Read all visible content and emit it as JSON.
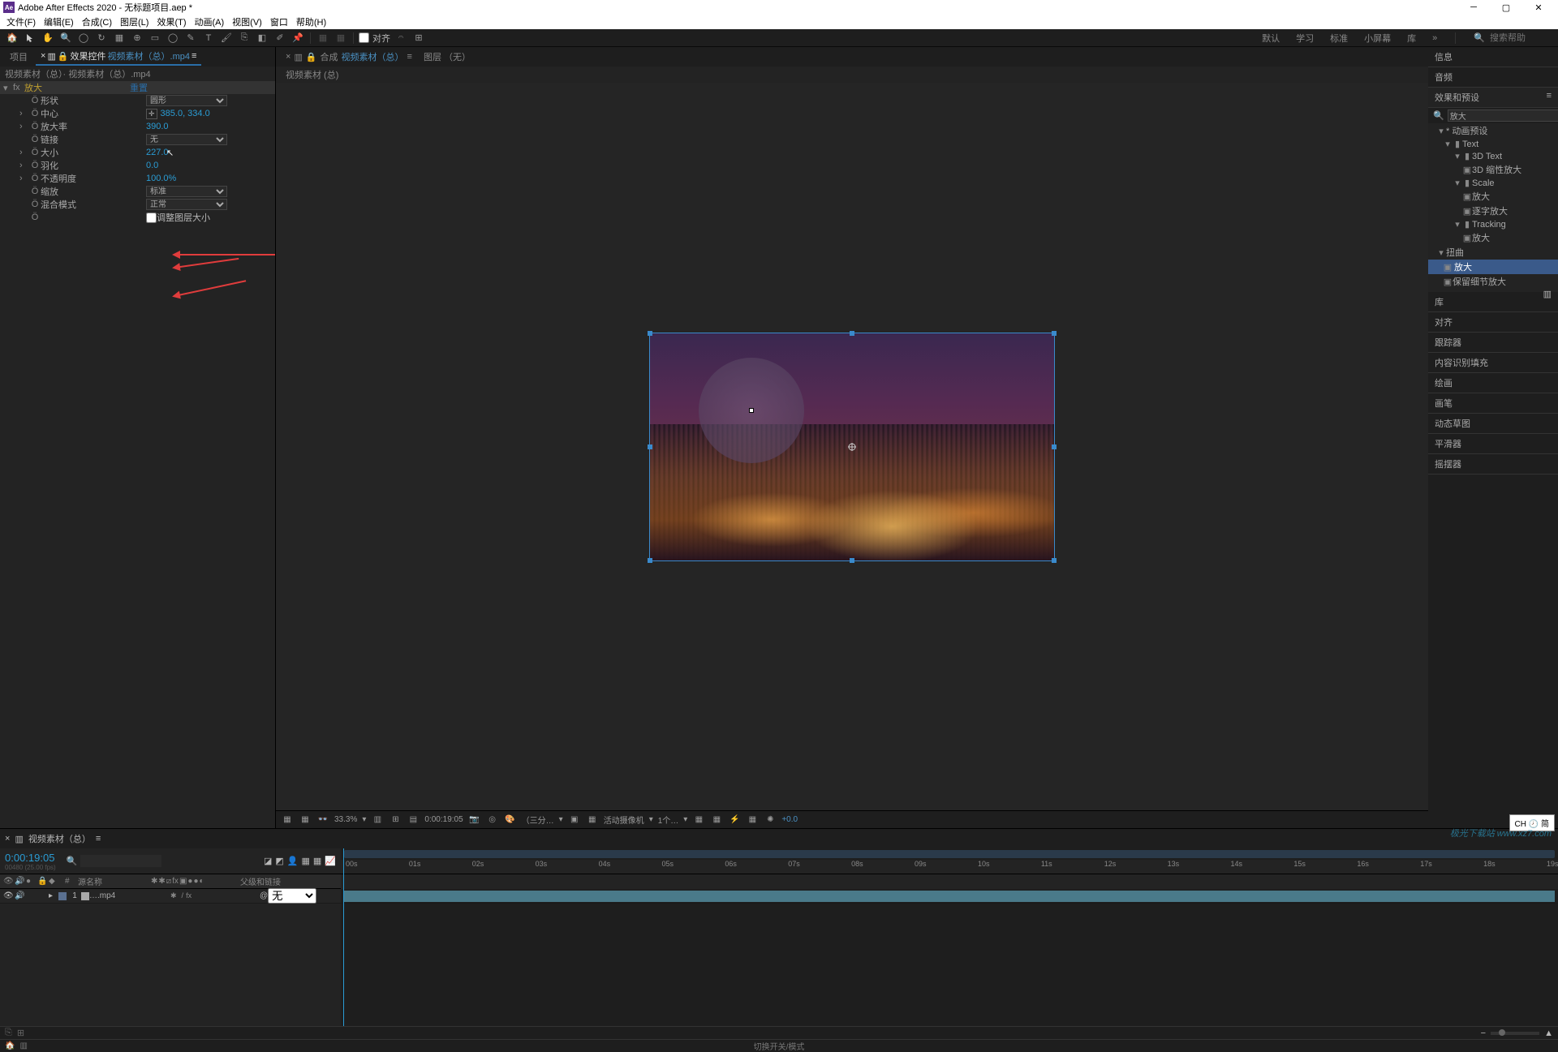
{
  "titlebar": {
    "app_icon_text": "Ae",
    "title": "Adobe After Effects 2020 - 无标题项目.aep *"
  },
  "menus": [
    "文件(F)",
    "编辑(E)",
    "合成(C)",
    "图层(L)",
    "效果(T)",
    "动画(A)",
    "视图(V)",
    "窗口",
    "帮助(H)"
  ],
  "toolbar": {
    "snap_label": "对齐",
    "workspaces": [
      "默认",
      "学习",
      "标准",
      "小屏幕",
      "库"
    ],
    "search_placeholder": "搜索帮助"
  },
  "left_panel": {
    "tabs": {
      "project": "项目",
      "effect_controls": "效果控件",
      "effect_controls_suffix": "视频素材（总）.mp4"
    },
    "subheader": "视频素材（总）· 视频素材（总）.mp4",
    "effect_name": "放大",
    "reset": "重置",
    "rows": [
      {
        "name": "形状",
        "type": "select",
        "value": "圆形"
      },
      {
        "name": "中心",
        "type": "coord",
        "value": "385.0, 334.0",
        "has_crosshair": true
      },
      {
        "name": "放大率",
        "type": "num",
        "value": "390.0"
      },
      {
        "name": "链接",
        "type": "select",
        "value": "无"
      },
      {
        "name": "大小",
        "type": "num",
        "value": "227.0"
      },
      {
        "name": "羽化",
        "type": "num",
        "value": "0.0"
      },
      {
        "name": "不透明度",
        "type": "num",
        "value": "100.0%"
      },
      {
        "name": "缩放",
        "type": "select",
        "value": "标准"
      },
      {
        "name": "混合模式",
        "type": "select",
        "value": "正常"
      },
      {
        "name": "",
        "type": "check",
        "value": "调整图层大小"
      }
    ]
  },
  "center": {
    "tab_prefix": "合成",
    "tab_name": "视频素材（总）",
    "layer_label": "图层 （无）",
    "comp_name": "视频素材 (总)",
    "bottom": {
      "zoom": "33.3%",
      "time": "0:00:19:05",
      "res": "（三分…",
      "camera": "活动摄像机",
      "views": "1个…",
      "exposure": "+0.0"
    }
  },
  "right": {
    "sections": [
      "信息",
      "音频"
    ],
    "effects_presets": "效果和预设",
    "search_value": "放大",
    "tree": {
      "root": "动画预设",
      "n_text": "Text",
      "n_3d": "3D Text",
      "n_3d_item": "3D 缩性放大",
      "n_scale": "Scale",
      "n_scale_1": "放大",
      "n_scale_2": "逐字放大",
      "n_track": "Tracking",
      "n_track_1": "放大",
      "n_distort": "扭曲",
      "n_distort_1": "放大",
      "n_distort_2": "保留细节放大"
    },
    "sections2": [
      "库",
      "对齐",
      "跟踪器",
      "内容识别填充",
      "绘画",
      "画笔",
      "动态草图",
      "平滑器",
      "摇摆器"
    ]
  },
  "timeline": {
    "tab": "视频素材（总）",
    "time": "0:00:19:05",
    "subtime": "00480 (25.00 fps)",
    "search_placeholder": "",
    "col_source": "源名称",
    "col_parent": "父级和链接",
    "layer": {
      "num": "1",
      "name": "….mp4",
      "parent": "无"
    },
    "ticks": [
      "00s",
      "01s",
      "02s",
      "03s",
      "04s",
      "05s",
      "06s",
      "07s",
      "08s",
      "09s",
      "10s",
      "11s",
      "12s",
      "13s",
      "14s",
      "15s",
      "16s",
      "17s",
      "18s",
      "19s"
    ]
  },
  "status_center": "切换开关/模式",
  "help_marker": "CH 🕗 简",
  "watermark": "极光下载站\nwww.xz7.com"
}
